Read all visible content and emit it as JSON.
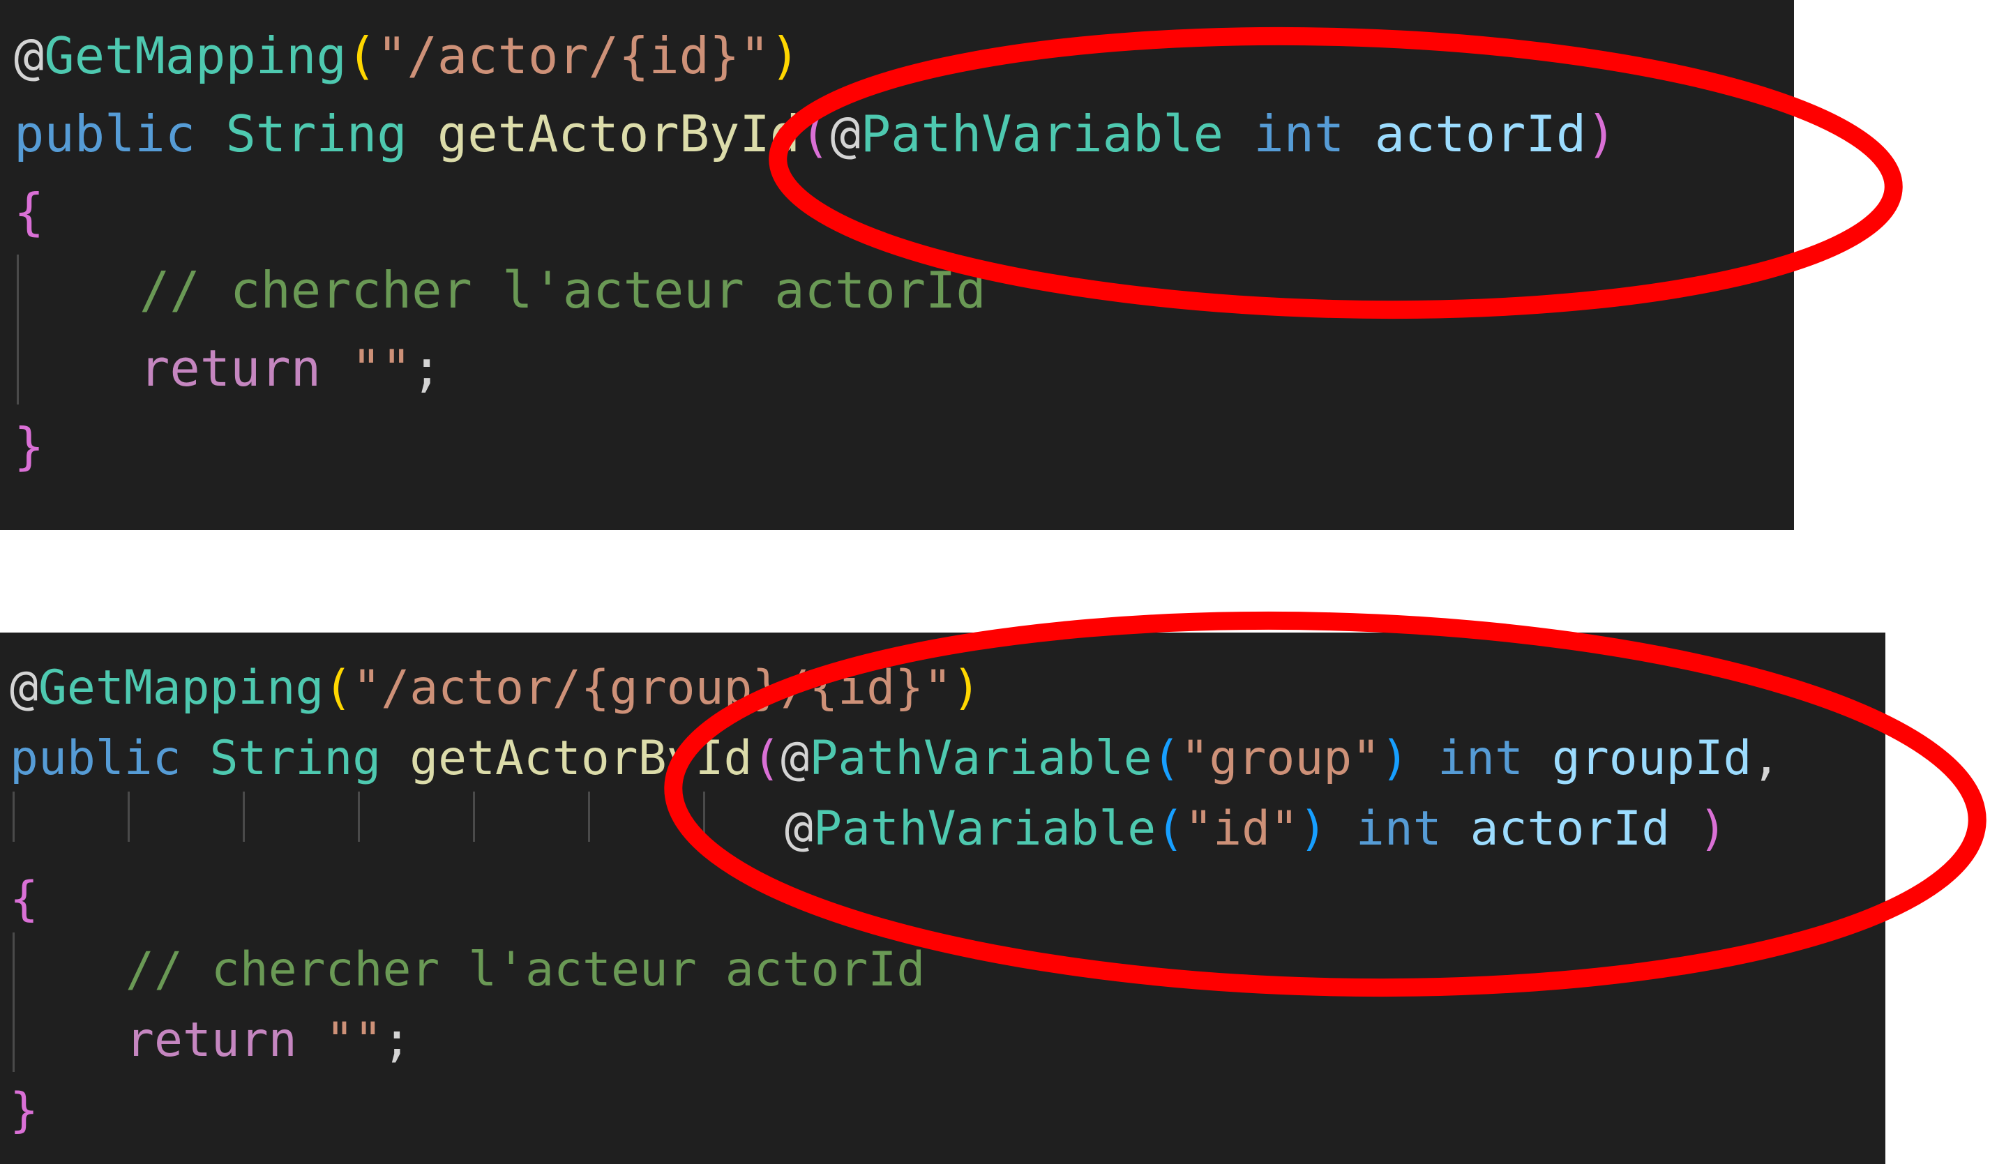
{
  "colors": {
    "background": "#1f1f1f",
    "highlight_ellipse": "#ff0000",
    "annotation": "#4ec9b0",
    "string": "#ce9178",
    "keyword": "#569cd6",
    "function": "#dcdcaa",
    "variable": "#9cdcfe",
    "comment": "#6a9955",
    "control": "#c586c0"
  },
  "top_snippet": {
    "l1_at": "@",
    "l1_annotation": "GetMapping",
    "l1_open": "(",
    "l1_path": "\"/actor/{id}\"",
    "l1_close": ")",
    "l2_public": "public",
    "l2_type": "String",
    "l2_method": "getActorById",
    "l2_open": "(",
    "l2_at": "@",
    "l2_annotation": "PathVariable",
    "l2_int": "int",
    "l2_param": "actorId",
    "l2_close": ")",
    "l3_brace": "{",
    "l4_comment": "// chercher l'acteur actorId",
    "l5_return": "return",
    "l5_value": "\"\"",
    "l5_semi": ";",
    "l6_brace": "}"
  },
  "bottom_snippet": {
    "l1_at": "@",
    "l1_annotation": "GetMapping",
    "l1_open": "(",
    "l1_path": "\"/actor/{group}/{id}\"",
    "l1_close": ")",
    "l2_public": "public",
    "l2_type": "String",
    "l2_method": "getActorById",
    "l2_open": "(",
    "l2_at": "@",
    "l2_annotation": "PathVariable",
    "l2_ann_open": "(",
    "l2_ann_value": "\"group\"",
    "l2_ann_close": ")",
    "l2_int": "int",
    "l2_param": "groupId",
    "l2_comma": ",",
    "l3_at": "@",
    "l3_annotation": "PathVariable",
    "l3_ann_open": "(",
    "l3_ann_value": "\"id\"",
    "l3_ann_close": ")",
    "l3_int": "int",
    "l3_param": "actorId",
    "l3_close": ")",
    "l4_brace": "{",
    "l5_comment": "// chercher l'acteur actorId",
    "l6_return": "return",
    "l6_value": "\"\"",
    "l6_semi": ";",
    "l7_brace": "}"
  }
}
